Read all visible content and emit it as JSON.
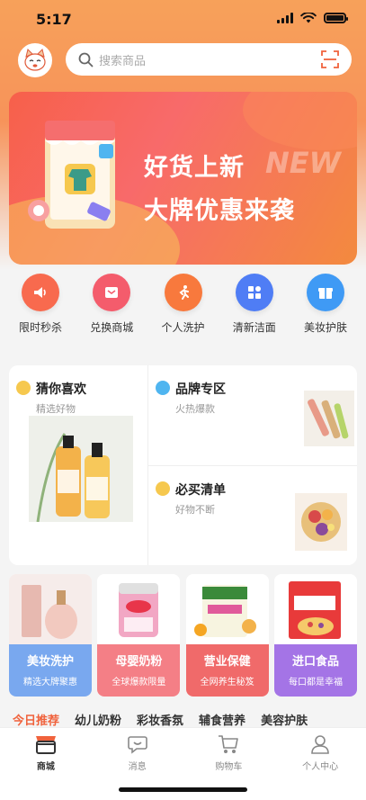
{
  "status": {
    "time": "5:17"
  },
  "search": {
    "placeholder": "搜索商品"
  },
  "banner": {
    "line1": "好货上新",
    "line2": "大牌优惠来袭",
    "deco": "NEW"
  },
  "categories": [
    {
      "label": "限时秒杀",
      "icon": "speaker-icon",
      "color": "#f86a4e"
    },
    {
      "label": "兑换商城",
      "icon": "gift-card-icon",
      "color": "#f45c6c"
    },
    {
      "label": "个人洗护",
      "icon": "runner-icon",
      "color": "#f8793d"
    },
    {
      "label": "清新洁面",
      "icon": "grid-icon",
      "color": "#4f7df5"
    },
    {
      "label": "美妆护肤",
      "icon": "gift-icon",
      "color": "#3f9af5"
    }
  ],
  "recommend": {
    "left": {
      "title": "猜你喜欢",
      "subtitle": "精选好物"
    },
    "top_right": {
      "title": "品牌专区",
      "subtitle": "火热爆款"
    },
    "bottom_right": {
      "title": "必买清单",
      "subtitle": "好物不断"
    }
  },
  "products": [
    {
      "title": "美妆洗护",
      "subtitle": "精选大牌聚惠",
      "color": "#79a8ef"
    },
    {
      "title": "母婴奶粉",
      "subtitle": "全球爆款限量",
      "color": "#f47f86"
    },
    {
      "title": "营业保健",
      "subtitle": "全网养生秘笈",
      "color": "#f06a6a"
    },
    {
      "title": "进口食品",
      "subtitle": "每口都是幸福",
      "color": "#a474e6"
    }
  ],
  "tabs": [
    "今日推荐",
    "幼儿奶粉",
    "彩妆香氛",
    "辅食营养",
    "美容护肤"
  ],
  "tabbar": [
    {
      "label": "商城",
      "icon": "store-icon"
    },
    {
      "label": "消息",
      "icon": "message-icon"
    },
    {
      "label": "购物车",
      "icon": "cart-icon"
    },
    {
      "label": "个人中心",
      "icon": "person-icon"
    }
  ]
}
